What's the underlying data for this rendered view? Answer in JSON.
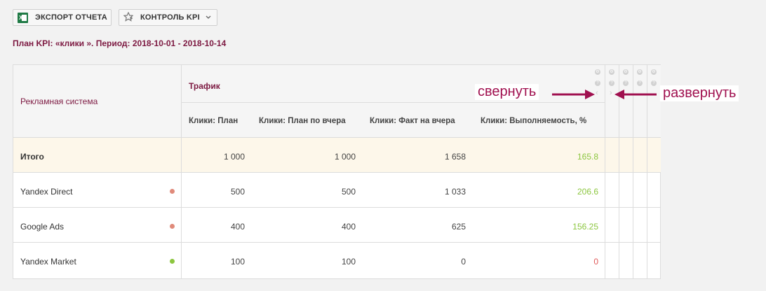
{
  "toolbar": {
    "export_label": "Экспорт отчета",
    "kpi_label": "Контроль KPI"
  },
  "plan_title": "План KPI: «клики ». Период: 2018-10-01 - 2018-10-14",
  "table": {
    "col_system": "Рекламная система",
    "group_traffic": "Трафик",
    "columns": [
      "Клики: План",
      "Клики: План по вчера",
      "Клики: Факт на вчера",
      "Клики: Выполняемость, %"
    ],
    "total": {
      "name": "Итого",
      "values": [
        "1 000",
        "1 000",
        "1 658",
        "165.8"
      ]
    },
    "rows": [
      {
        "name": "Yandex Direct",
        "status": "red",
        "values": [
          "500",
          "500",
          "1 033",
          "206.6"
        ]
      },
      {
        "name": "Google Ads",
        "status": "red",
        "values": [
          "400",
          "400",
          "625",
          "156.25"
        ]
      },
      {
        "name": "Yandex Market",
        "status": "green",
        "values": [
          "100",
          "100",
          "0",
          "0"
        ]
      }
    ]
  },
  "annotations": {
    "collapse": "свернуть",
    "expand": "развернуть"
  },
  "colors": {
    "accent": "#7d1a42",
    "arrow": "#a0104f",
    "ok": "#8cc63f",
    "bad": "#e05a5a",
    "total_bg": "#fdf7ea"
  }
}
